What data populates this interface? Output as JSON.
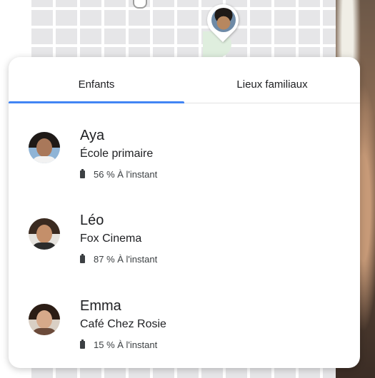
{
  "tabs": [
    {
      "label": "Enfants",
      "selected": true
    },
    {
      "label": "Lieux familiaux",
      "selected": false
    }
  ],
  "children": [
    {
      "name": "Aya",
      "place": "École primaire",
      "battery": "56 %",
      "time": "À l'instant"
    },
    {
      "name": "Léo",
      "place": "Fox Cinema",
      "battery": "87 %",
      "time": "À l'instant"
    },
    {
      "name": "Emma",
      "place": "Café Chez Rosie",
      "battery": "15 %",
      "time": "À l'instant"
    }
  ],
  "colors": {
    "tab_indicator": "#4285f4",
    "text_primary": "#202124",
    "text_secondary": "#3c4043"
  },
  "icons": {
    "battery": "battery-icon",
    "map_pin": "map-pin-icon"
  }
}
